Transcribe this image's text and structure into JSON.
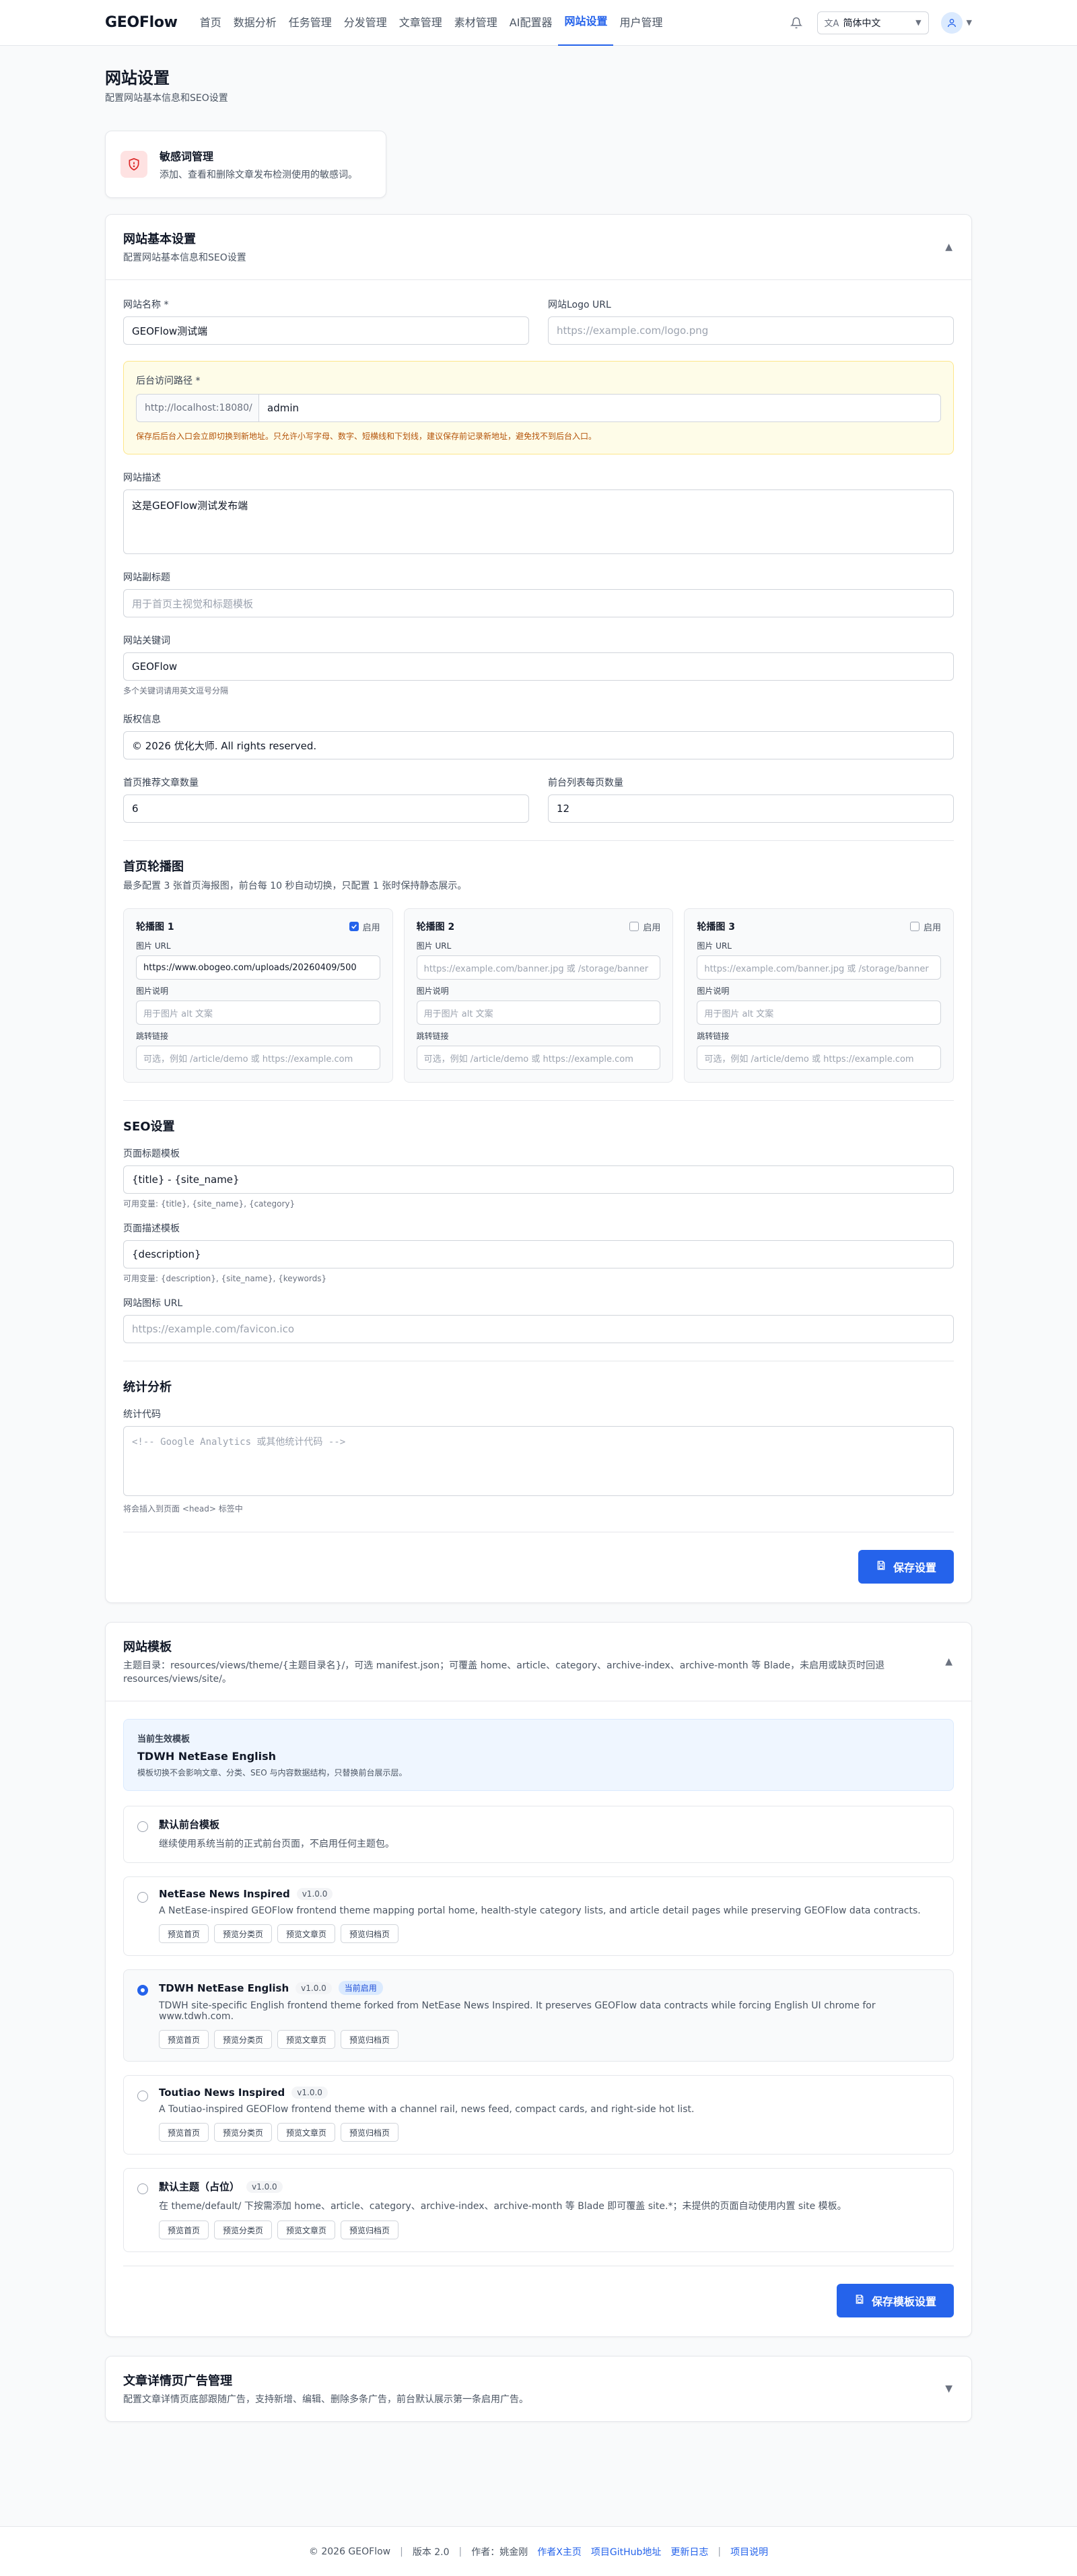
{
  "nav": {
    "logo": "GEOFlow",
    "links": [
      "首页",
      "数据分析",
      "任务管理",
      "分发管理",
      "文章管理",
      "素材管理",
      "AI配置器",
      "网站设置",
      "用户管理"
    ],
    "active_index": 7,
    "language": "简体中文"
  },
  "page": {
    "title": "网站设置",
    "subtitle": "配置网站基本信息和SEO设置"
  },
  "sensitive": {
    "title": "敏感词管理",
    "desc": "添加、查看和删除文章发布检测使用的敏感词。"
  },
  "basic": {
    "title": "网站基本设置",
    "subtitle": "配置网站基本信息和SEO设置",
    "site_name_label": "网站名称 *",
    "site_name_value": "GEOFlow测试端",
    "logo_label": "网站Logo URL",
    "logo_placeholder": "https://example.com/logo.png",
    "admin_label": "后台访问路径 *",
    "admin_prefix": "http://localhost:18080/",
    "admin_value": "admin",
    "admin_warn": "保存后后台入口会立即切换到新地址。只允许小写字母、数字、短横线和下划线，建议保存前记录新地址，避免找不到后台入口。",
    "desc_label": "网站描述",
    "desc_value": "这是GEOFlow测试发布端",
    "subtitle_label": "网站副标题",
    "subtitle_placeholder": "用于首页主视觉和标题模板",
    "keywords_label": "网站关键词",
    "keywords_value": "GEOFlow",
    "keywords_hint": "多个关键词请用英文逗号分隔",
    "copyright_label": "版权信息",
    "copyright_value": "© 2026 优化大师. All rights reserved.",
    "home_count_label": "首页推荐文章数量",
    "home_count_value": "6",
    "list_count_label": "前台列表每页数量",
    "list_count_value": "12"
  },
  "carousel": {
    "title": "首页轮播图",
    "subtitle": "最多配置 3 张首页海报图，前台每 10 秒自动切换，只配置 1 张时保持静态展示。",
    "enable_label": "启用",
    "img_label": "图片 URL",
    "alt_label": "图片说明",
    "link_label": "跳转链接",
    "alt_placeholder": "用于图片 alt 文案",
    "link_placeholder": "可选，例如 /article/demo 或 https://example.com",
    "img_placeholder": "https://example.com/banner.jpg 或 /storage/banner",
    "items": [
      {
        "title": "轮播图 1",
        "enabled": true,
        "img_value": "https://www.obogeo.com/uploads/20260409/500"
      },
      {
        "title": "轮播图 2",
        "enabled": false,
        "img_value": ""
      },
      {
        "title": "轮播图 3",
        "enabled": false,
        "img_value": ""
      }
    ]
  },
  "seo": {
    "title": "SEO设置",
    "title_tpl_label": "页面标题模板",
    "title_tpl_value": "{title} - {site_name}",
    "title_tpl_hint": "可用变量: {title}, {site_name}, {category}",
    "desc_tpl_label": "页面描述模板",
    "desc_tpl_value": "{description}",
    "desc_tpl_hint": "可用变量: {description}, {site_name}, {keywords}",
    "favicon_label": "网站图标 URL",
    "favicon_placeholder": "https://example.com/favicon.ico"
  },
  "analytics": {
    "title": "统计分析",
    "code_label": "统计代码",
    "code_placeholder": "<!-- Google Analytics 或其他统计代码 -->",
    "code_hint": "将会插入到页面 <head> 标签中",
    "save_label": "保存设置"
  },
  "templates": {
    "title": "网站模板",
    "subtitle": "主题目录：resources/views/theme/{主题目录名}/，可选 manifest.json；可覆盖 home、article、category、archive-index、archive-month 等 Blade，未启用或缺页时回退 resources/views/site/。",
    "current_label": "当前生效模板",
    "current_name": "TDWH NetEase English",
    "current_desc": "模板切换不会影响文章、分类、SEO 与内容数据结构，只替换前台展示层。",
    "current_badge": "当前启用",
    "preview_buttons": [
      "预览首页",
      "预览分类页",
      "预览文章页",
      "预览归档页"
    ],
    "items": [
      {
        "name": "默认前台模板",
        "version": "",
        "desc": "继续使用系统当前的正式前台页面，不启用任何主题包。",
        "selected": false,
        "current": false,
        "previews": false
      },
      {
        "name": "NetEase News Inspired",
        "version": "v1.0.0",
        "desc": "A NetEase-inspired GEOFlow frontend theme mapping portal home, health-style category lists, and article detail pages while preserving GEOFlow data contracts.",
        "selected": false,
        "current": false,
        "previews": true
      },
      {
        "name": "TDWH NetEase English",
        "version": "v1.0.0",
        "desc": "TDWH site-specific English frontend theme forked from NetEase News Inspired. It preserves GEOFlow data contracts while forcing English UI chrome for www.tdwh.com.",
        "selected": true,
        "current": true,
        "previews": true
      },
      {
        "name": "Toutiao News Inspired",
        "version": "v1.0.0",
        "desc": "A Toutiao-inspired GEOFlow frontend theme with a channel rail, news feed, compact cards, and right-side hot list.",
        "selected": false,
        "current": false,
        "previews": true
      },
      {
        "name": "默认主题（占位）",
        "version": "v1.0.0",
        "desc": "在 theme/default/ 下按需添加 home、article、category、archive-index、archive-month 等 Blade 即可覆盖 site.*；未提供的页面自动使用内置 site 模板。",
        "selected": false,
        "current": false,
        "previews": true
      }
    ],
    "save_label": "保存模板设置"
  },
  "ads": {
    "title": "文章详情页广告管理",
    "subtitle": "配置文章详情页底部跟随广告，支持新增、编辑、删除多条广告，前台默认展示第一条启用广告。"
  },
  "footer": {
    "copyright": "© 2026 GEOFlow",
    "version": "版本 2.0",
    "author": "作者：姚金刚",
    "links": [
      "作者X主页",
      "项目GitHub地址",
      "更新日志",
      "项目说明"
    ]
  },
  "colors": {
    "accent": "#2563eb",
    "warning_bg": "#fefce8",
    "danger": "#dc2626"
  }
}
